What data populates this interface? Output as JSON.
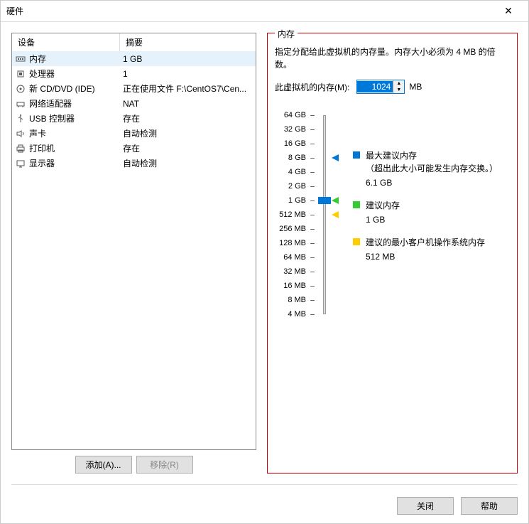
{
  "window": {
    "title": "硬件"
  },
  "deviceTable": {
    "headers": {
      "device": "设备",
      "summary": "摘要"
    },
    "rows": [
      {
        "icon": "memory-icon",
        "name": "内存",
        "summary": "1 GB",
        "selected": true
      },
      {
        "icon": "cpu-icon",
        "name": "处理器",
        "summary": "1"
      },
      {
        "icon": "cd-icon",
        "name": "新 CD/DVD (IDE)",
        "summary": "正在使用文件 F:\\CentOS7\\Cen..."
      },
      {
        "icon": "network-icon",
        "name": "网络适配器",
        "summary": "NAT"
      },
      {
        "icon": "usb-icon",
        "name": "USB 控制器",
        "summary": "存在"
      },
      {
        "icon": "sound-icon",
        "name": "声卡",
        "summary": "自动检测"
      },
      {
        "icon": "printer-icon",
        "name": "打印机",
        "summary": "存在"
      },
      {
        "icon": "display-icon",
        "name": "显示器",
        "summary": "自动检测"
      }
    ]
  },
  "leftButtons": {
    "add": "添加(A)...",
    "remove": "移除(R)"
  },
  "rightPanel": {
    "title": "内存",
    "description": "指定分配给此虚拟机的内存量。内存大小必须为 4 MB 的倍数。",
    "memoryLabel": "此虚拟机的内存(M):",
    "memoryValue": "1024",
    "memoryUnit": "MB",
    "sliderLabels": [
      "64 GB",
      "32 GB",
      "16 GB",
      "8 GB",
      "4 GB",
      "2 GB",
      "1 GB",
      "512 MB",
      "256 MB",
      "128 MB",
      "64 MB",
      "32 MB",
      "16 MB",
      "8 MB",
      "4 MB"
    ],
    "legend": {
      "max": {
        "label": "最大建议内存",
        "sub": "（超出此大小可能发生内存交换。）",
        "value": "6.1 GB"
      },
      "rec": {
        "label": "建议内存",
        "value": "1 GB"
      },
      "min": {
        "label": "建议的最小客户机操作系统内存",
        "value": "512 MB"
      }
    }
  },
  "bottomButtons": {
    "close": "关闭",
    "help": "帮助"
  }
}
